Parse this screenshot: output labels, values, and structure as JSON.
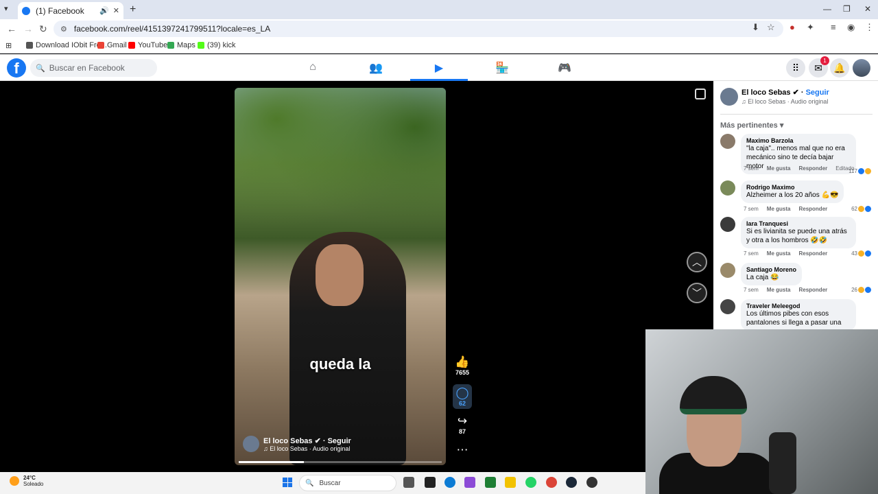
{
  "browser": {
    "tab_title": "(1) Facebook",
    "url": "facebook.com/reel/4151397241799511?locale=es_LA",
    "bookmarks": [
      "Download IObit Fre...",
      "Gmail",
      "YouTube",
      "Maps",
      "(39) kick"
    ]
  },
  "fb": {
    "search_placeholder": "Buscar en Facebook",
    "nav_icons": [
      "home-icon",
      "friends-icon",
      "reels-icon",
      "marketplace-icon",
      "gaming-icon"
    ],
    "messenger_badge": "1"
  },
  "reel": {
    "caption": "queda la",
    "author": "El loco Sebas",
    "follow": "Seguir",
    "audio": "El loco Sebas · Audio original",
    "progress_fraction": 0.32,
    "likes": "7655",
    "comments": "62",
    "shares": "87"
  },
  "panel": {
    "author": "El loco Sebas",
    "follow": "Seguir",
    "audio": "El loco Sebas · Audio original",
    "sort_label": "Más pertinentes",
    "comments": [
      {
        "author": "Maximo Barzola",
        "text": "\"la caja\".. menos mal que no era mecánico sino te decía bajar motor",
        "time": "7 sem",
        "like": "Me gusta",
        "reply": "Responder",
        "edited": "Editado",
        "count": "117"
      },
      {
        "author": "Rodrigo Maximo",
        "text": "Alzheimer a los 20 años 💪😎",
        "time": "7 sem",
        "like": "Me gusta",
        "reply": "Responder",
        "count": "62"
      },
      {
        "author": "Iara Tranquesi",
        "text": "Si es livianita se puede una atrás y otra a los hombros 🤣🤣",
        "time": "7 sem",
        "like": "Me gusta",
        "reply": "Responder",
        "count": "43"
      },
      {
        "author": "Santiago Moreno",
        "text": "La caja 😂",
        "time": "7 sem",
        "like": "Me gusta",
        "reply": "Responder",
        "count": "26"
      },
      {
        "author": "Traveler Meleegod",
        "text": "Los últimos pibes con esos pantalones si llega a pasar una"
      }
    ]
  },
  "taskbar": {
    "temp": "24°C",
    "condition": "Soleado",
    "search": "Buscar"
  },
  "colors": {
    "fb_blue": "#1877f2",
    "tab_strip": "#dee4f0"
  }
}
